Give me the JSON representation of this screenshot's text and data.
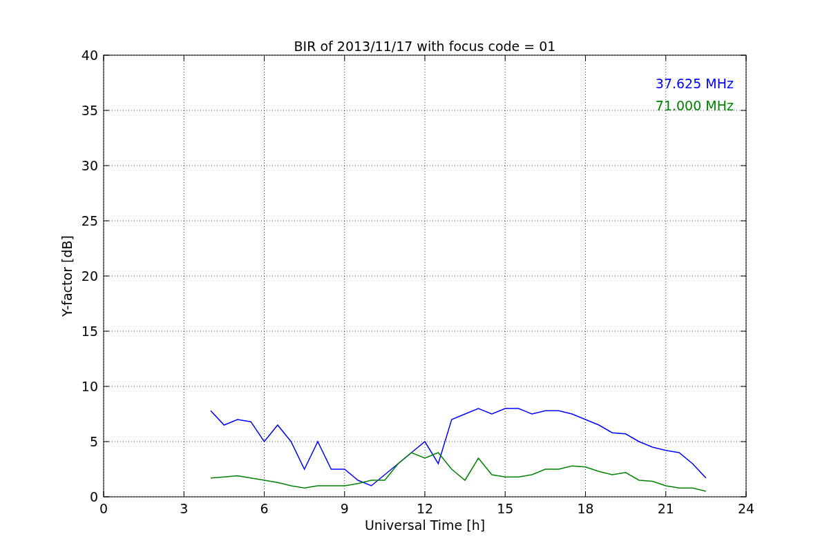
{
  "chart_data": {
    "type": "line",
    "title": "BIR of 2013/11/17 with focus code = 01",
    "xlabel": "Universal Time [h]",
    "ylabel": "Y-factor [dB]",
    "x": [
      4.0,
      4.5,
      5.0,
      5.5,
      6.0,
      6.5,
      7.0,
      7.5,
      8.0,
      8.5,
      9.0,
      9.5,
      10.0,
      10.5,
      11.0,
      11.5,
      12.0,
      12.5,
      13.0,
      13.5,
      14.0,
      14.5,
      15.0,
      15.5,
      16.0,
      16.5,
      17.0,
      17.5,
      18.0,
      18.5,
      19.0,
      19.5,
      20.0,
      20.5,
      21.0,
      21.5,
      22.0,
      22.5
    ],
    "series": [
      {
        "name": "37.625 MHz",
        "color": "#0000ff",
        "values": [
          7.8,
          6.5,
          7.0,
          6.8,
          5.0,
          6.5,
          5.0,
          2.5,
          5.0,
          2.5,
          2.5,
          1.5,
          1.0,
          2.0,
          3.0,
          4.0,
          5.0,
          3.0,
          7.0,
          7.5,
          8.0,
          7.5,
          8.0,
          8.0,
          7.5,
          7.8,
          7.8,
          7.5,
          7.0,
          6.5,
          5.8,
          5.7,
          5.0,
          4.5,
          4.2,
          4.0,
          3.0,
          1.7
        ]
      },
      {
        "name": "71.000 MHz",
        "color": "#008000",
        "values": [
          1.7,
          1.8,
          1.9,
          1.7,
          1.5,
          1.3,
          1.0,
          0.8,
          1.0,
          1.0,
          1.0,
          1.2,
          1.5,
          1.5,
          3.0,
          4.0,
          3.5,
          4.0,
          2.5,
          1.5,
          3.5,
          2.0,
          1.8,
          1.8,
          2.0,
          2.5,
          2.5,
          2.8,
          2.7,
          2.3,
          2.0,
          2.2,
          1.5,
          1.4,
          1.0,
          0.8,
          0.8,
          0.5
        ]
      }
    ],
    "grid": true,
    "xlim": [
      0,
      24
    ],
    "ylim": [
      0,
      40
    ],
    "xticks": [
      0,
      3,
      6,
      9,
      12,
      15,
      18,
      21,
      24
    ],
    "yticks": [
      0,
      5,
      10,
      15,
      20,
      25,
      30,
      35,
      40
    ]
  }
}
